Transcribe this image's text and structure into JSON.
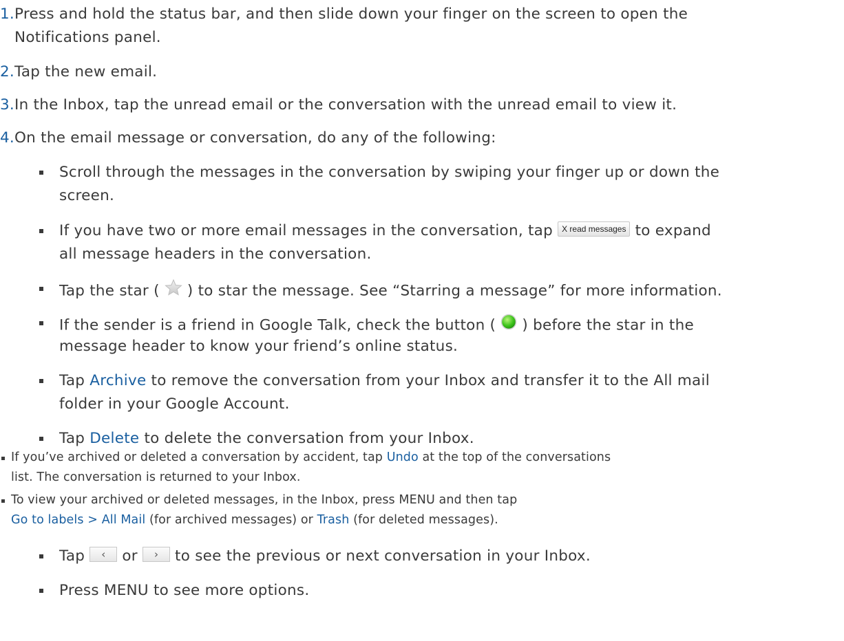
{
  "steps": [
    {
      "num": "1.",
      "line1": "Press and hold the status bar, and then slide down your finger on the screen to open the",
      "line2": "Notifications panel."
    },
    {
      "num": "2.",
      "line1": "Tap the new email."
    },
    {
      "num": "3.",
      "line1": "In the Inbox, tap the unread email or the conversation with the unread email to view it."
    },
    {
      "num": "4.",
      "line1": "On the email message or conversation, do any of the following:"
    }
  ],
  "bullets": {
    "scroll": {
      "line1": "Scroll through the messages in the conversation by swiping your finger up or down the",
      "line2": "screen."
    },
    "expand": {
      "pre": "If you have two or more email messages in the conversation, tap",
      "button_label": "X read messages",
      "post": "to expand",
      "line2": "all message headers in the conversation."
    },
    "star": {
      "pre": "Tap the star (",
      "post": ") to star the message. See “Starring a message” for more information."
    },
    "talk": {
      "pre": "If the sender is a friend in Google Talk, check the button (",
      "post": ") before the star in the",
      "line2": "message header to know your friend’s online status."
    },
    "archive": {
      "pre": "Tap",
      "word": "Archive",
      "post": "to remove the conversation from your Inbox and transfer it to the All mail",
      "line2": "folder in your Google Account."
    },
    "delete": {
      "pre": "Tap",
      "word": "Delete",
      "post": "to delete the conversation from your Inbox."
    },
    "undo": {
      "pre": "If you’ve archived or deleted a conversation by accident, tap",
      "word": "Undo",
      "post": "at the top of the conversations",
      "line2": "list. The conversation is returned to your Inbox."
    },
    "view": {
      "line1": "To view your archived or deleted messages, in the Inbox, press MENU and then tap",
      "word1": "Go to labels > All Mail",
      "mid": "(for archived messages) or",
      "word2": "Trash",
      "post": "(for deleted messages)."
    },
    "nav": {
      "pre": "Tap",
      "or": "or",
      "post": "to see the previous or next conversation in your Inbox.",
      "prev_glyph": "‹",
      "next_glyph": "›"
    },
    "menu": {
      "line1": "Press MENU to see more options."
    }
  },
  "colors": {
    "text": "#3a3a3a",
    "accent": "#1a5fa0",
    "star": "#d8d8d8",
    "status_online": "#3ec41c"
  }
}
